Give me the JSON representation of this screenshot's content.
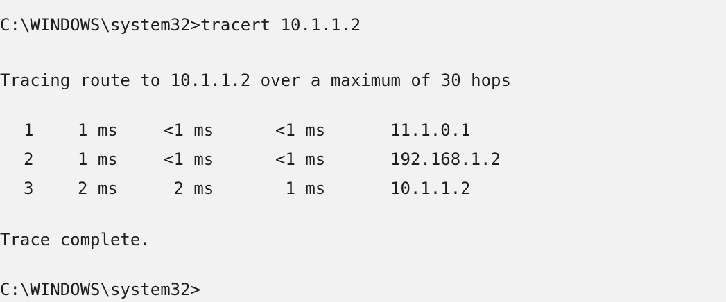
{
  "console": {
    "command_line": "C:\\WINDOWS\\system32>tracert 10.1.1.2",
    "header": "Tracing route to 10.1.1.2 over a maximum of 30 hops",
    "hops": [
      {
        "hop": "1",
        "t1": "1 ms",
        "t2": "<1 ms",
        "t3": "<1 ms",
        "address": "11.1.0.1"
      },
      {
        "hop": "2",
        "t1": "1 ms",
        "t2": "<1 ms",
        "t3": "<1 ms",
        "address": "192.168.1.2"
      },
      {
        "hop": "3",
        "t1": "2 ms",
        "t2": " 2 ms",
        "t3": " 1 ms",
        "address": "10.1.1.2"
      }
    ],
    "footer": "Trace complete.",
    "prompt": "C:\\WINDOWS\\system32>"
  }
}
